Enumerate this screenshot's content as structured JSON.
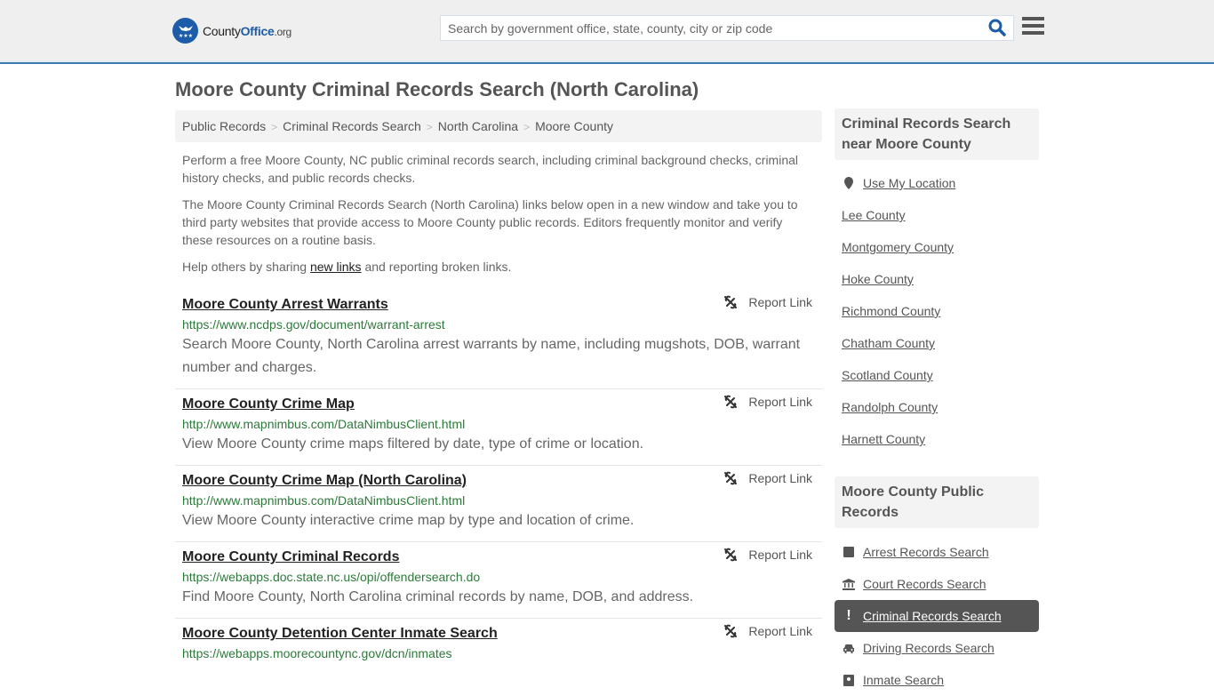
{
  "header": {
    "logo": {
      "name": "County",
      "name_accent": "Office",
      "tld": ".org"
    },
    "search": {
      "placeholder": "Search by government office, state, county, city or zip code",
      "value": ""
    },
    "colors": {
      "brand": "#1d5ca8",
      "header_border": "#3a7cb0"
    }
  },
  "page": {
    "title": "Moore County Criminal Records Search (North Carolina)",
    "breadcrumb": [
      "Public Records",
      "Criminal Records Search",
      "North Carolina",
      "Moore County"
    ],
    "intro": {
      "p1": "Perform a free Moore County, NC public criminal records search, including criminal background checks, criminal history checks, and public records checks.",
      "p2": "The Moore County Criminal Records Search (North Carolina) links below open in a new window and take you to third party websites that provide access to Moore County public records. Editors frequently monitor and verify these resources on a routine basis.",
      "p3_before": "Help others by sharing ",
      "p3_link": "new links",
      "p3_after": " and reporting broken links."
    }
  },
  "results": [
    {
      "title": "Moore County Arrest Warrants",
      "url": "https://www.ncdps.gov/document/warrant-arrest",
      "desc": "Search Moore County, North Carolina arrest warrants by name, including mugshots, DOB, warrant number and charges.",
      "report": "Report Link"
    },
    {
      "title": "Moore County Crime Map",
      "url": "http://www.mapnimbus.com/DataNimbusClient.html",
      "desc": "View Moore County crime maps filtered by date, type of crime or location.",
      "report": "Report Link"
    },
    {
      "title": "Moore County Crime Map (North Carolina)",
      "url": "http://www.mapnimbus.com/DataNimbusClient.html",
      "desc": "View Moore County interactive crime map by type and location of crime.",
      "report": "Report Link"
    },
    {
      "title": "Moore County Criminal Records",
      "url": "https://webapps.doc.state.nc.us/opi/offendersearch.do",
      "desc": "Find Moore County, North Carolina criminal records by name, DOB, and address.",
      "report": "Report Link"
    },
    {
      "title": "Moore County Detention Center Inmate Search",
      "url": "https://webapps.moorecountync.gov/dcn/inmates",
      "desc": "",
      "report": "Report Link"
    }
  ],
  "sidebar": {
    "nearby": {
      "heading": "Criminal Records Search near Moore County",
      "use_location": "Use My Location",
      "counties": [
        "Lee County",
        "Montgomery County",
        "Hoke County",
        "Richmond County",
        "Chatham County",
        "Scotland County",
        "Randolph County",
        "Harnett County"
      ]
    },
    "records": {
      "heading": "Moore County Public Records",
      "items": [
        {
          "label": "Arrest Records Search",
          "icon": "square-icon",
          "active": false
        },
        {
          "label": "Court Records Search",
          "icon": "courthouse-icon",
          "active": false
        },
        {
          "label": "Criminal Records Search",
          "icon": "exclamation-icon",
          "active": true
        },
        {
          "label": "Driving Records Search",
          "icon": "car-icon",
          "active": false
        },
        {
          "label": "Inmate Search",
          "icon": "inmate-icon",
          "active": false
        }
      ]
    }
  }
}
